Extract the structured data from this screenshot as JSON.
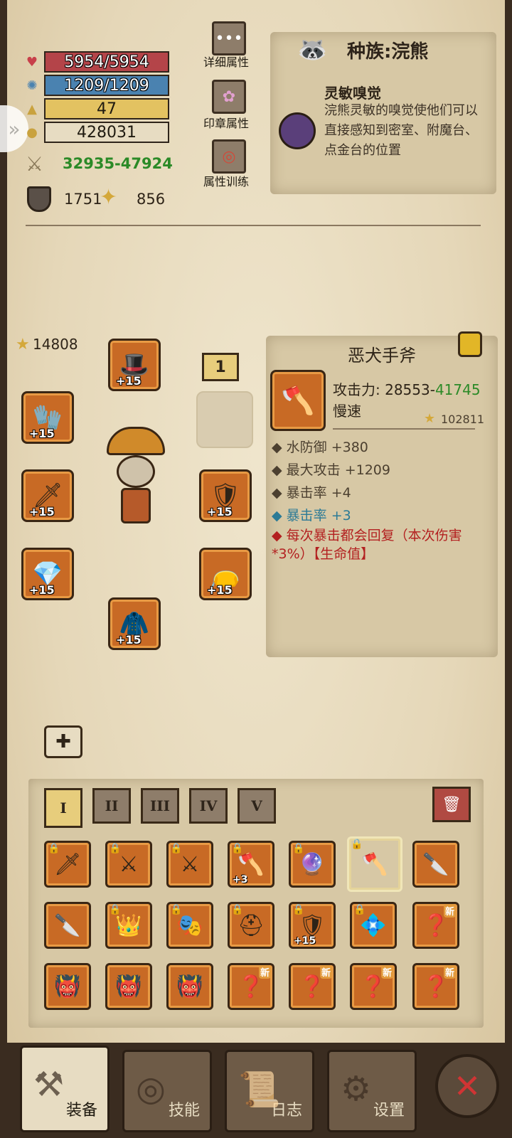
{
  "stats": {
    "hp": "5954/5954",
    "mp": "1209/1209",
    "level": "47",
    "gold": "428031",
    "attack_range": "32935-47924",
    "defense": "1751",
    "luck": "856"
  },
  "menu": {
    "detail_label": "详细属性",
    "seal_label": "印章属性",
    "training_label": "属性训练"
  },
  "race": {
    "title": "种族:浣熊",
    "ability_title": "灵敏嗅觉",
    "ability_desc": "浣熊灵敏的嗅觉使他们可以直接感知到密室、附魔台、点金台的位置"
  },
  "equipment": {
    "power": "14808",
    "badge": "1",
    "slots": [
      {
        "name": "hat",
        "level": "+15"
      },
      {
        "name": "gloves",
        "level": "+15"
      },
      {
        "name": "weapon-left",
        "level": "+15"
      },
      {
        "name": "bracer",
        "level": "+15"
      },
      {
        "name": "shield",
        "level": "+15"
      },
      {
        "name": "belt",
        "level": "+15"
      },
      {
        "name": "armor",
        "level": "+15"
      }
    ]
  },
  "item": {
    "name": "恶犬手斧",
    "atk_label": "攻击力: 28553-",
    "atk_max": "41745",
    "speed": "慢速",
    "power": "102811",
    "stats": [
      "水防御 +380",
      "最大攻击 +1209",
      "暴击率 +4"
    ],
    "bonus_stat": "暴击率 +3",
    "special": "每次暴击都会回复（本次伤害*3%）【生命值】"
  },
  "inventory": {
    "tabs": [
      "I",
      "II",
      "III",
      "IV",
      "V"
    ],
    "new_label": "新",
    "plus3": "+3",
    "plus15": "+15"
  },
  "nav": {
    "equip": "装备",
    "skills": "技能",
    "log": "日志",
    "settings": "设置"
  },
  "colors": {
    "hp": "#b44449",
    "mp": "#4a82b0",
    "level": "#e3c261",
    "green": "#2b8a27",
    "red_text": "#b32020"
  }
}
